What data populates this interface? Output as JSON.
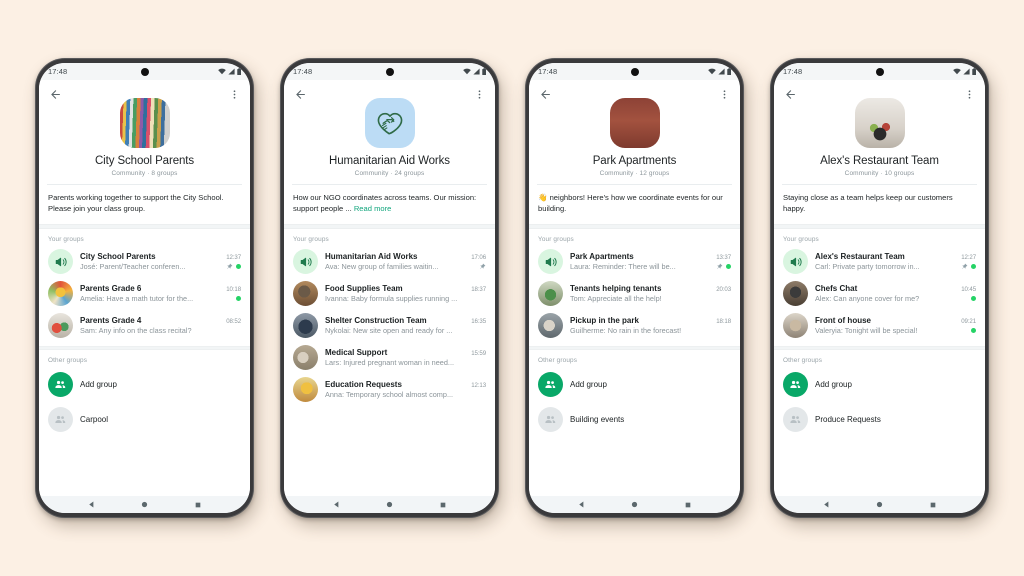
{
  "background_color": "#FCF0E4",
  "accent_green": "#12a67d",
  "unread_dot_color": "#25d366",
  "add_group_color": "#09a868",
  "status_bar": {
    "time": "17:48",
    "icons": [
      "wifi-icon",
      "signal-icon",
      "battery-icon"
    ]
  },
  "nav_bar": {
    "back": "back-triangle-icon",
    "home": "home-circle-icon",
    "recents": "recents-square-icon"
  },
  "header_icons": {
    "back": "back-arrow-icon",
    "menu": "overflow-menu-icon"
  },
  "labels": {
    "your_groups": "Your groups",
    "other_groups": "Other groups",
    "read_more": "Read more"
  },
  "phones": [
    {
      "avatar_style": "ph-books",
      "avatar_kind": "photo",
      "name": "City School Parents",
      "subtitle": "Community · 8 groups",
      "description": "Parents working together to support the City School. Please join your class group.",
      "description_emoji": "",
      "has_read_more": false,
      "your_groups": [
        {
          "avatar_style": "announce",
          "title": "City School Parents",
          "time": "12:37",
          "message": "José: Parent/Teacher conferen...",
          "pinned": true,
          "unread": true
        },
        {
          "avatar_style": "ph-a1",
          "title": "Parents Grade 6",
          "time": "10:18",
          "message": "Amelia: Have a math tutor for the...",
          "pinned": false,
          "unread": true
        },
        {
          "avatar_style": "ph-a2",
          "title": "Parents Grade 4",
          "time": "08:52",
          "message": "Sam: Any info on the class recital?",
          "pinned": false,
          "unread": false
        }
      ],
      "other_groups": [
        {
          "type": "add",
          "label": "Add group"
        },
        {
          "type": "plain",
          "label": "Carpool"
        }
      ]
    },
    {
      "avatar_style": "logo-heart",
      "avatar_kind": "logo",
      "name": "Humanitarian Aid Works",
      "subtitle": "Community · 24 groups",
      "description": "How our NGO coordinates across teams. Our mission: support people ...",
      "description_emoji": "",
      "has_read_more": true,
      "your_groups": [
        {
          "avatar_style": "announce",
          "title": "Humanitarian Aid Works",
          "time": "17:06",
          "message": "Ava: New group of families waitin...",
          "pinned": true,
          "unread": false
        },
        {
          "avatar_style": "ph-a3",
          "title": "Food Supplies Team",
          "time": "18:37",
          "message": "Ivanna: Baby formula supplies running ...",
          "pinned": false,
          "unread": false
        },
        {
          "avatar_style": "ph-a4",
          "title": "Shelter Construction Team",
          "time": "16:35",
          "message": "Nykolai: New site open and ready for ...",
          "pinned": false,
          "unread": false
        },
        {
          "avatar_style": "ph-a5",
          "title": "Medical Support",
          "time": "15:59",
          "message": "Lars: Injured pregnant woman in need...",
          "pinned": false,
          "unread": false
        },
        {
          "avatar_style": "ph-a6",
          "title": "Education Requests",
          "time": "12:13",
          "message": "Anna: Temporary school almost comp...",
          "pinned": false,
          "unread": false
        }
      ],
      "other_groups": []
    },
    {
      "avatar_style": "ph-bldg",
      "avatar_kind": "photo",
      "name": "Park Apartments",
      "subtitle": "Community · 12 groups",
      "description": "neighbors! Here's how we coordinate events for our building.",
      "description_emoji": "👋",
      "has_read_more": false,
      "your_groups": [
        {
          "avatar_style": "announce",
          "title": "Park Apartments",
          "time": "13:37",
          "message": "Laura: Reminder: There will be...",
          "pinned": true,
          "unread": true
        },
        {
          "avatar_style": "ph-a7",
          "title": "Tenants helping tenants",
          "time": "20:03",
          "message": "Tom: Appreciate all the help!",
          "pinned": false,
          "unread": false
        },
        {
          "avatar_style": "ph-a8",
          "title": "Pickup in the park",
          "time": "18:18",
          "message": "Guilherme: No rain in the forecast!",
          "pinned": false,
          "unread": false
        }
      ],
      "other_groups": [
        {
          "type": "add",
          "label": "Add group"
        },
        {
          "type": "plain",
          "label": "Building events"
        }
      ]
    },
    {
      "avatar_style": "ph-food",
      "avatar_kind": "photo",
      "name": "Alex's Restaurant Team",
      "subtitle": "Community · 10 groups",
      "description": "Staying close as a team helps keep our customers happy.",
      "description_emoji": "",
      "has_read_more": false,
      "your_groups": [
        {
          "avatar_style": "announce",
          "title": "Alex's Restaurant Team",
          "time": "12:27",
          "message": "Carl: Private party tomorrow in...",
          "pinned": true,
          "unread": true
        },
        {
          "avatar_style": "ph-a9",
          "title": "Chefs Chat",
          "time": "10:45",
          "message": "Alex: Can anyone cover for me?",
          "pinned": false,
          "unread": true
        },
        {
          "avatar_style": "ph-a10",
          "title": "Front of house",
          "time": "09:21",
          "message": "Valeryia: Tonight will be special!",
          "pinned": false,
          "unread": true
        }
      ],
      "other_groups": [
        {
          "type": "add",
          "label": "Add group"
        },
        {
          "type": "plain",
          "label": "Produce Requests"
        }
      ]
    }
  ]
}
